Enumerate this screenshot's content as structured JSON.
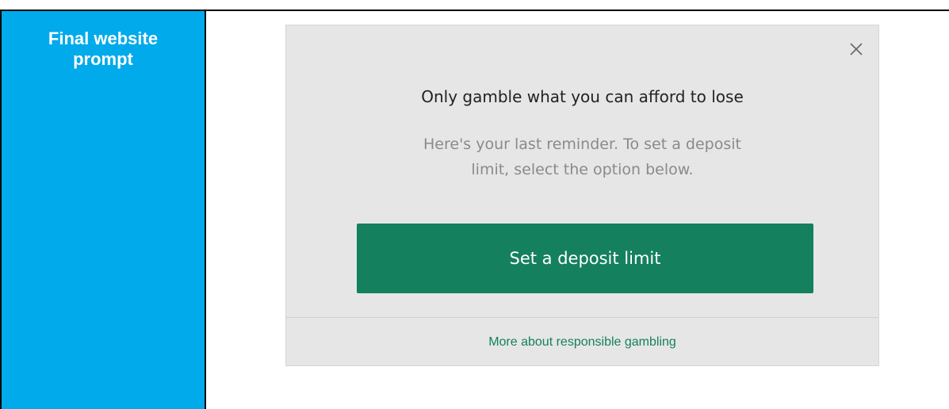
{
  "table": {
    "label": "Final website\nprompt"
  },
  "popup": {
    "close_icon": "close-icon",
    "headline": "Only gamble what you can afford to lose",
    "subtext_line1": "Here's your last reminder. To set a deposit",
    "subtext_line2": "limit, select the option below.",
    "cta_label": "Set a deposit limit",
    "footer_link": "More about responsible gambling",
    "colors": {
      "label_bg": "#00aaeb",
      "popup_bg": "#e6e6e6",
      "cta_bg": "#14805e",
      "link": "#14805e"
    }
  }
}
